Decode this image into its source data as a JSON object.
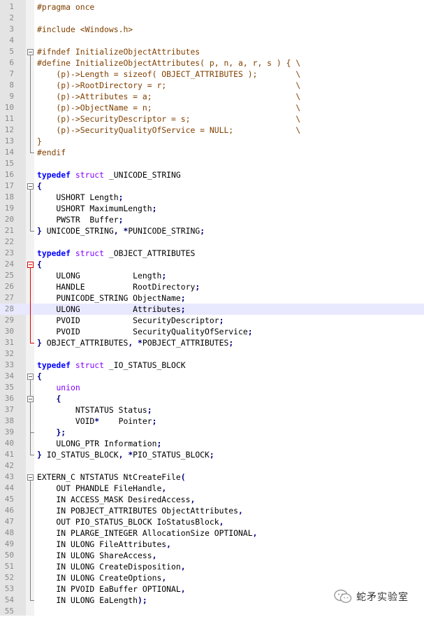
{
  "editor": {
    "current_line": 28,
    "lines": [
      [
        {
          "t": "#pragma once",
          "c": "pp"
        }
      ],
      [],
      [
        {
          "t": "#include <Windows.h>",
          "c": "pp"
        }
      ],
      [],
      [
        {
          "t": "#ifndef InitializeObjectAttributes",
          "c": "pp"
        }
      ],
      [
        {
          "t": "#define InitializeObjectAttributes( p, n, a, r, s ) { \\",
          "c": "pp"
        }
      ],
      [
        {
          "t": "    (p)->Length = sizeof( OBJECT_ATTRIBUTES );        \\",
          "c": "pp"
        }
      ],
      [
        {
          "t": "    (p)->RootDirectory = r;                           \\",
          "c": "pp"
        }
      ],
      [
        {
          "t": "    (p)->Attributes = a;                              \\",
          "c": "pp"
        }
      ],
      [
        {
          "t": "    (p)->ObjectName = n;                              \\",
          "c": "pp"
        }
      ],
      [
        {
          "t": "    (p)->SecurityDescriptor = s;                      \\",
          "c": "pp"
        }
      ],
      [
        {
          "t": "    (p)->SecurityQualityOfService = NULL;             \\",
          "c": "pp"
        }
      ],
      [
        {
          "t": "}",
          "c": "pp"
        }
      ],
      [
        {
          "t": "#endif",
          "c": "pp"
        }
      ],
      [],
      [
        {
          "t": "typedef",
          "c": "kw"
        },
        {
          "t": " "
        },
        {
          "t": "struct",
          "c": "kw2"
        },
        {
          "t": " _UNICODE_STRING"
        }
      ],
      [
        {
          "t": "{",
          "c": "op"
        }
      ],
      [
        {
          "t": "    USHORT Length"
        },
        {
          "t": ";",
          "c": "op"
        }
      ],
      [
        {
          "t": "    USHORT MaximumLength"
        },
        {
          "t": ";",
          "c": "op"
        }
      ],
      [
        {
          "t": "    PWSTR  Buffer"
        },
        {
          "t": ";",
          "c": "op"
        }
      ],
      [
        {
          "t": "}",
          "c": "op"
        },
        {
          "t": " UNICODE_STRING"
        },
        {
          "t": ",",
          "c": "op"
        },
        {
          "t": " "
        },
        {
          "t": "*",
          "c": "op"
        },
        {
          "t": "PUNICODE_STRING"
        },
        {
          "t": ";",
          "c": "op"
        }
      ],
      [],
      [
        {
          "t": "typedef",
          "c": "kw"
        },
        {
          "t": " "
        },
        {
          "t": "struct",
          "c": "kw2"
        },
        {
          "t": " _OBJECT_ATTRIBUTES"
        }
      ],
      [
        {
          "t": "{",
          "c": "op"
        }
      ],
      [
        {
          "t": "    ULONG           Length"
        },
        {
          "t": ";",
          "c": "op"
        }
      ],
      [
        {
          "t": "    HANDLE          RootDirectory"
        },
        {
          "t": ";",
          "c": "op"
        }
      ],
      [
        {
          "t": "    PUNICODE_STRING ObjectName"
        },
        {
          "t": ";",
          "c": "op"
        }
      ],
      [
        {
          "t": "    ULONG           Attributes"
        },
        {
          "t": ";",
          "c": "op"
        }
      ],
      [
        {
          "t": "    PVOID           SecurityDescriptor"
        },
        {
          "t": ";",
          "c": "op"
        }
      ],
      [
        {
          "t": "    PVOID           SecurityQualityOfService"
        },
        {
          "t": ";",
          "c": "op"
        }
      ],
      [
        {
          "t": "}",
          "c": "op"
        },
        {
          "t": " OBJECT_ATTRIBUTES"
        },
        {
          "t": ",",
          "c": "op"
        },
        {
          "t": " "
        },
        {
          "t": "*",
          "c": "op"
        },
        {
          "t": "POBJECT_ATTRIBUTES"
        },
        {
          "t": ";",
          "c": "op"
        }
      ],
      [],
      [
        {
          "t": "typedef",
          "c": "kw"
        },
        {
          "t": " "
        },
        {
          "t": "struct",
          "c": "kw2"
        },
        {
          "t": " _IO_STATUS_BLOCK"
        }
      ],
      [
        {
          "t": "{",
          "c": "op"
        }
      ],
      [
        {
          "t": "    "
        },
        {
          "t": "union",
          "c": "kw2"
        }
      ],
      [
        {
          "t": "    "
        },
        {
          "t": "{",
          "c": "op"
        }
      ],
      [
        {
          "t": "        NTSTATUS Status"
        },
        {
          "t": ";",
          "c": "op"
        }
      ],
      [
        {
          "t": "        VOID"
        },
        {
          "t": "*",
          "c": "op"
        },
        {
          "t": "    Pointer"
        },
        {
          "t": ";",
          "c": "op"
        }
      ],
      [
        {
          "t": "    "
        },
        {
          "t": "};",
          "c": "op"
        }
      ],
      [
        {
          "t": "    ULONG_PTR Information"
        },
        {
          "t": ";",
          "c": "op"
        }
      ],
      [
        {
          "t": "}",
          "c": "op"
        },
        {
          "t": " IO_STATUS_BLOCK"
        },
        {
          "t": ",",
          "c": "op"
        },
        {
          "t": " "
        },
        {
          "t": "*",
          "c": "op"
        },
        {
          "t": "PIO_STATUS_BLOCK"
        },
        {
          "t": ";",
          "c": "op"
        }
      ],
      [],
      [
        {
          "t": "EXTERN_C NTSTATUS NtCreateFile"
        },
        {
          "t": "(",
          "c": "op"
        }
      ],
      [
        {
          "t": "    OUT PHANDLE FileHandle"
        },
        {
          "t": ",",
          "c": "op"
        }
      ],
      [
        {
          "t": "    IN ACCESS_MASK DesiredAccess"
        },
        {
          "t": ",",
          "c": "op"
        }
      ],
      [
        {
          "t": "    IN POBJECT_ATTRIBUTES ObjectAttributes"
        },
        {
          "t": ",",
          "c": "op"
        }
      ],
      [
        {
          "t": "    OUT PIO_STATUS_BLOCK IoStatusBlock"
        },
        {
          "t": ",",
          "c": "op"
        }
      ],
      [
        {
          "t": "    IN PLARGE_INTEGER AllocationSize OPTIONAL"
        },
        {
          "t": ",",
          "c": "op"
        }
      ],
      [
        {
          "t": "    IN ULONG FileAttributes"
        },
        {
          "t": ",",
          "c": "op"
        }
      ],
      [
        {
          "t": "    IN ULONG ShareAccess"
        },
        {
          "t": ",",
          "c": "op"
        }
      ],
      [
        {
          "t": "    IN ULONG CreateDisposition"
        },
        {
          "t": ",",
          "c": "op"
        }
      ],
      [
        {
          "t": "    IN ULONG CreateOptions"
        },
        {
          "t": ",",
          "c": "op"
        }
      ],
      [
        {
          "t": "    IN PVOID EaBuffer OPTIONAL"
        },
        {
          "t": ",",
          "c": "op"
        }
      ],
      [
        {
          "t": "    IN ULONG EaLength"
        },
        {
          "t": ");",
          "c": "op"
        }
      ],
      []
    ]
  },
  "watermark": {
    "text": "蛇矛实验室",
    "icon": "wechat-icon"
  },
  "colors": {
    "preprocessor": "#804000",
    "keyword": "#0000ff",
    "type_keyword": "#8000ff",
    "operator": "#000080",
    "current_line_bg": "#e8e8ff",
    "fold_active": "#e00000"
  }
}
